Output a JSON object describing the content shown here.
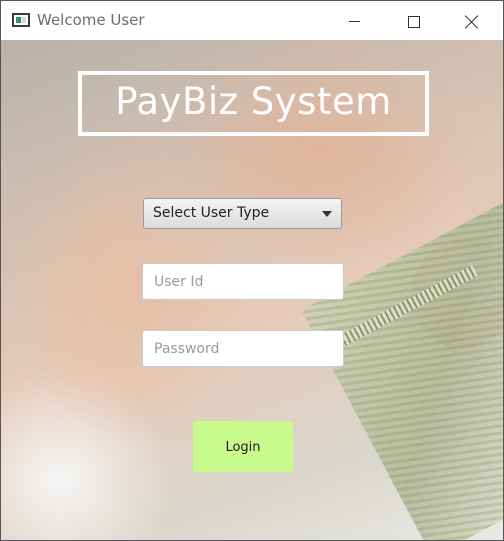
{
  "window": {
    "title": "Welcome User",
    "controls": {
      "minimize": "minimize",
      "maximize": "maximize",
      "close": "close"
    }
  },
  "app": {
    "title": "PayBiz System"
  },
  "form": {
    "user_type": {
      "selected": "Select User Type"
    },
    "user_id": {
      "placeholder": "User Id",
      "value": ""
    },
    "password": {
      "placeholder": "Password",
      "value": ""
    },
    "login_label": "Login"
  },
  "colors": {
    "login_button": "#c8fa8c",
    "title_text": "#ffffff"
  }
}
